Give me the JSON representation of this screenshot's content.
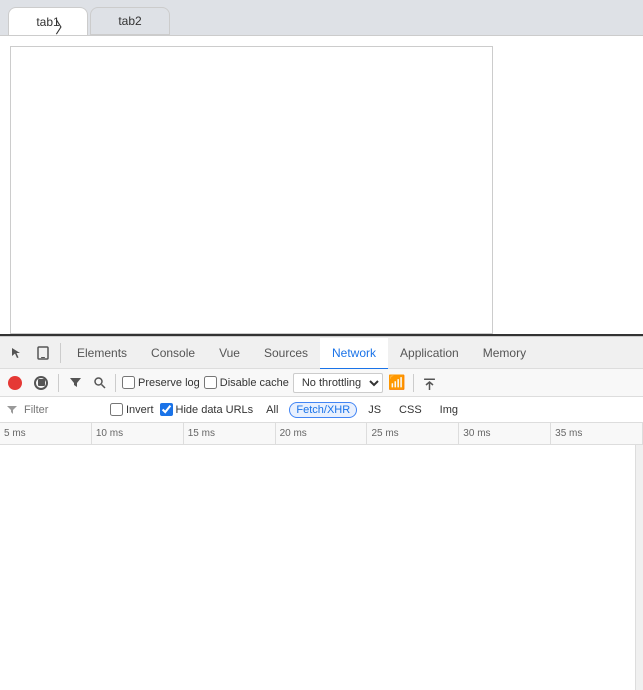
{
  "browser": {
    "tabs": [
      {
        "label": "tab1",
        "active": true
      },
      {
        "label": "tab2",
        "active": false
      }
    ]
  },
  "devtools": {
    "toolbar_icons": [
      "cursor-icon",
      "panel-icon"
    ],
    "tabs": [
      {
        "label": "Elements",
        "active": false
      },
      {
        "label": "Console",
        "active": false
      },
      {
        "label": "Vue",
        "active": false
      },
      {
        "label": "Sources",
        "active": false
      },
      {
        "label": "Network",
        "active": true
      },
      {
        "label": "Application",
        "active": false
      },
      {
        "label": "Memory",
        "active": false
      }
    ],
    "network": {
      "preserve_log_label": "Preserve log",
      "disable_cache_label": "Disable cache",
      "throttle_value": "No throttling",
      "filter_placeholder": "Filter",
      "invert_label": "Invert",
      "hide_data_urls_label": "Hide data URLs",
      "all_label": "All",
      "filter_types": [
        "Fetch/XHR",
        "JS",
        "CSS",
        "Img"
      ],
      "active_filter": "Fetch/XHR",
      "timeline_ticks": [
        "5 ms",
        "10 ms",
        "15 ms",
        "20 ms",
        "25 ms",
        "30 ms",
        "35 ms"
      ]
    }
  }
}
